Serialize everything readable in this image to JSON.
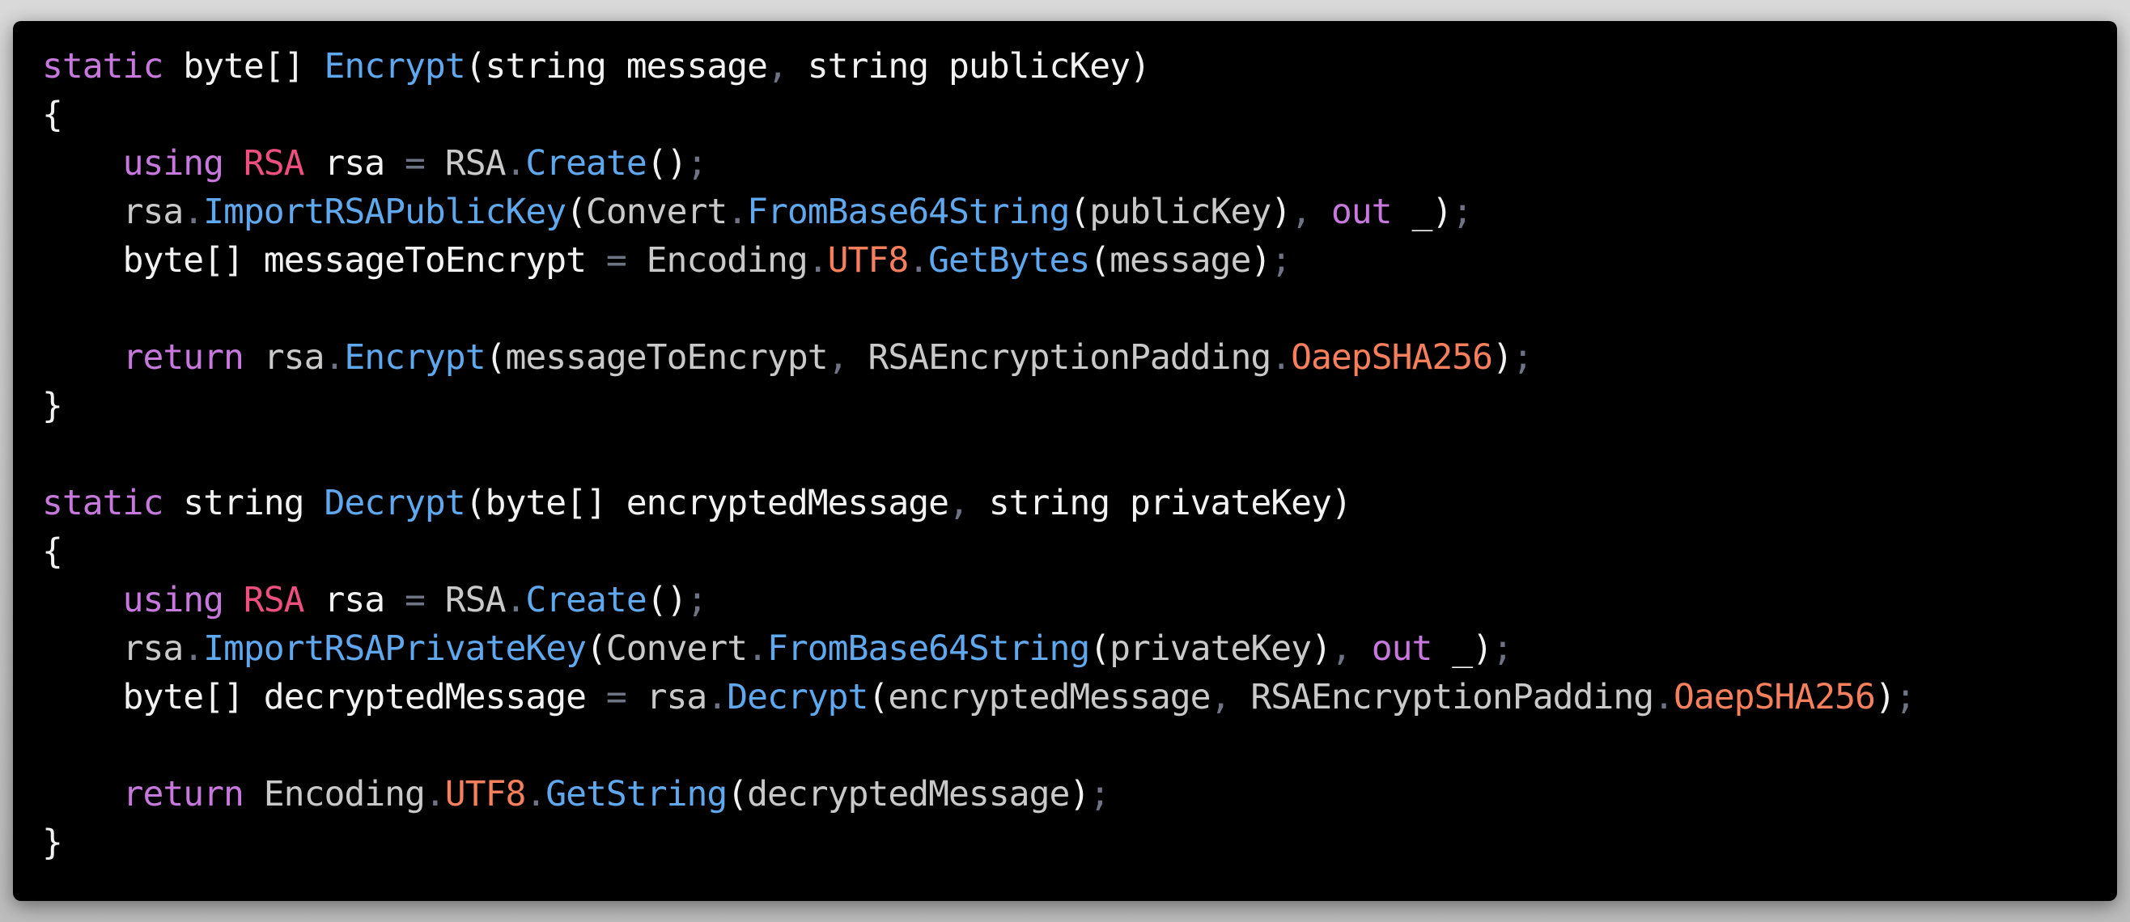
{
  "colors": {
    "background": "#000000",
    "keyword": "#c678dd",
    "type_red": "#ef4f7f",
    "function": "#5fa8ee",
    "property": "#f77f5c",
    "punctuation": "#6e7484",
    "class": "#c9c9c9",
    "text": "#f2f2f2"
  },
  "code_lines": [
    [
      [
        "kw",
        "static"
      ],
      [
        "text",
        " byte[] "
      ],
      [
        "fn",
        "Encrypt"
      ],
      [
        "text",
        "(string message"
      ],
      [
        "punct",
        ","
      ],
      [
        "text",
        " string publicKey)"
      ]
    ],
    [
      [
        "text",
        "{"
      ]
    ],
    [
      [
        "text",
        "    "
      ],
      [
        "kw",
        "using"
      ],
      [
        "text",
        " "
      ],
      [
        "type_red",
        "RSA"
      ],
      [
        "text",
        " rsa "
      ],
      [
        "punct",
        "="
      ],
      [
        "text",
        " "
      ],
      [
        "class",
        "RSA"
      ],
      [
        "punct",
        "."
      ],
      [
        "fn",
        "Create"
      ],
      [
        "text",
        "()"
      ],
      [
        "punct",
        ";"
      ]
    ],
    [
      [
        "text",
        "    "
      ],
      [
        "class",
        "rsa"
      ],
      [
        "punct",
        "."
      ],
      [
        "fn",
        "ImportRSAPublicKey"
      ],
      [
        "text",
        "("
      ],
      [
        "class",
        "Convert"
      ],
      [
        "punct",
        "."
      ],
      [
        "fn",
        "FromBase64String"
      ],
      [
        "text",
        "("
      ],
      [
        "class",
        "publicKey"
      ],
      [
        "text",
        ")"
      ],
      [
        "punct",
        ","
      ],
      [
        "text",
        " "
      ],
      [
        "kw",
        "out"
      ],
      [
        "text",
        " _)"
      ],
      [
        "punct",
        ";"
      ]
    ],
    [
      [
        "text",
        "    byte[] messageToEncrypt "
      ],
      [
        "punct",
        "="
      ],
      [
        "text",
        " "
      ],
      [
        "class",
        "Encoding"
      ],
      [
        "punct",
        "."
      ],
      [
        "prop",
        "UTF8"
      ],
      [
        "punct",
        "."
      ],
      [
        "fn",
        "GetBytes"
      ],
      [
        "text",
        "("
      ],
      [
        "class",
        "message"
      ],
      [
        "text",
        ")"
      ],
      [
        "punct",
        ";"
      ]
    ],
    [
      [
        "text",
        ""
      ]
    ],
    [
      [
        "text",
        "    "
      ],
      [
        "kw",
        "return"
      ],
      [
        "text",
        " "
      ],
      [
        "class",
        "rsa"
      ],
      [
        "punct",
        "."
      ],
      [
        "fn",
        "Encrypt"
      ],
      [
        "text",
        "("
      ],
      [
        "class",
        "messageToEncrypt"
      ],
      [
        "punct",
        ","
      ],
      [
        "text",
        " "
      ],
      [
        "class",
        "RSAEncryptionPadding"
      ],
      [
        "punct",
        "."
      ],
      [
        "prop",
        "OaepSHA256"
      ],
      [
        "text",
        ")"
      ],
      [
        "punct",
        ";"
      ]
    ],
    [
      [
        "text",
        "}"
      ]
    ],
    [
      [
        "text",
        ""
      ]
    ],
    [
      [
        "kw",
        "static"
      ],
      [
        "text",
        " string "
      ],
      [
        "fn",
        "Decrypt"
      ],
      [
        "text",
        "(byte[] encryptedMessage"
      ],
      [
        "punct",
        ","
      ],
      [
        "text",
        " string privateKey)"
      ]
    ],
    [
      [
        "text",
        "{"
      ]
    ],
    [
      [
        "text",
        "    "
      ],
      [
        "kw",
        "using"
      ],
      [
        "text",
        " "
      ],
      [
        "type_red",
        "RSA"
      ],
      [
        "text",
        " rsa "
      ],
      [
        "punct",
        "="
      ],
      [
        "text",
        " "
      ],
      [
        "class",
        "RSA"
      ],
      [
        "punct",
        "."
      ],
      [
        "fn",
        "Create"
      ],
      [
        "text",
        "()"
      ],
      [
        "punct",
        ";"
      ]
    ],
    [
      [
        "text",
        "    "
      ],
      [
        "class",
        "rsa"
      ],
      [
        "punct",
        "."
      ],
      [
        "fn",
        "ImportRSAPrivateKey"
      ],
      [
        "text",
        "("
      ],
      [
        "class",
        "Convert"
      ],
      [
        "punct",
        "."
      ],
      [
        "fn",
        "FromBase64String"
      ],
      [
        "text",
        "("
      ],
      [
        "class",
        "privateKey"
      ],
      [
        "text",
        ")"
      ],
      [
        "punct",
        ","
      ],
      [
        "text",
        " "
      ],
      [
        "kw",
        "out"
      ],
      [
        "text",
        " _)"
      ],
      [
        "punct",
        ";"
      ]
    ],
    [
      [
        "text",
        "    byte[] decryptedMessage "
      ],
      [
        "punct",
        "="
      ],
      [
        "text",
        " "
      ],
      [
        "class",
        "rsa"
      ],
      [
        "punct",
        "."
      ],
      [
        "fn",
        "Decrypt"
      ],
      [
        "text",
        "("
      ],
      [
        "class",
        "encryptedMessage"
      ],
      [
        "punct",
        ","
      ],
      [
        "text",
        " "
      ],
      [
        "class",
        "RSAEncryptionPadding"
      ],
      [
        "punct",
        "."
      ],
      [
        "prop",
        "OaepSHA256"
      ],
      [
        "text",
        ")"
      ],
      [
        "punct",
        ";"
      ]
    ],
    [
      [
        "text",
        ""
      ]
    ],
    [
      [
        "text",
        "    "
      ],
      [
        "kw",
        "return"
      ],
      [
        "text",
        " "
      ],
      [
        "class",
        "Encoding"
      ],
      [
        "punct",
        "."
      ],
      [
        "prop",
        "UTF8"
      ],
      [
        "punct",
        "."
      ],
      [
        "fn",
        "GetString"
      ],
      [
        "text",
        "("
      ],
      [
        "class",
        "decryptedMessage"
      ],
      [
        "text",
        ")"
      ],
      [
        "punct",
        ";"
      ]
    ],
    [
      [
        "text",
        "}"
      ]
    ]
  ]
}
